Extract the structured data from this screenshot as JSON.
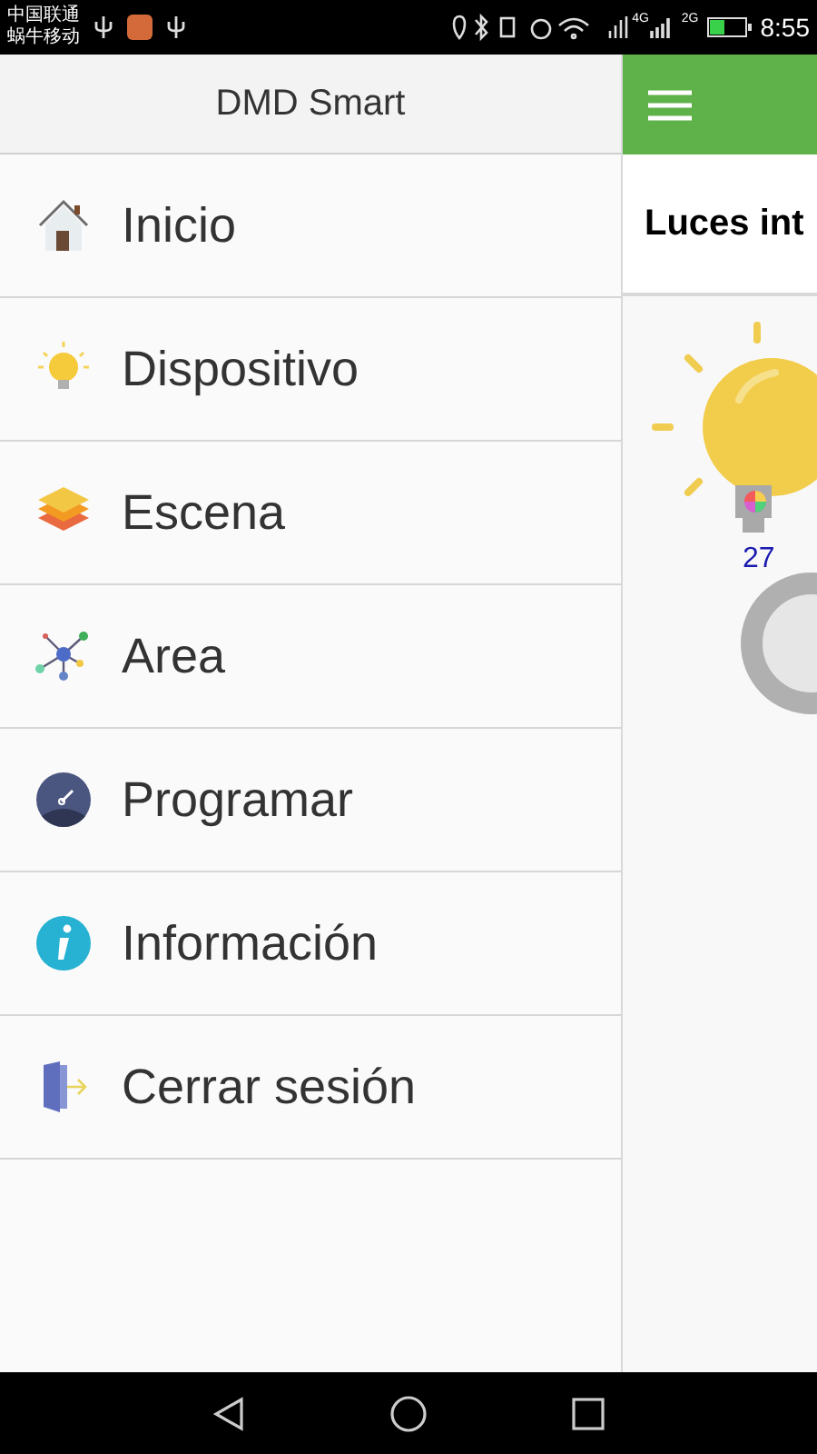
{
  "status_bar": {
    "carriers": [
      "中国联通",
      "蜗牛移动"
    ],
    "network_labels": [
      "4G",
      "2G"
    ],
    "time": "8:55"
  },
  "drawer": {
    "title": "DMD Smart",
    "items": [
      {
        "label": "Inicio",
        "kind": "home"
      },
      {
        "label": "Dispositivo",
        "kind": "bulb"
      },
      {
        "label": "Escena",
        "kind": "layers"
      },
      {
        "label": "Area",
        "kind": "network"
      },
      {
        "label": "Programar",
        "kind": "gauge"
      },
      {
        "label": "Información",
        "kind": "info"
      },
      {
        "label": "Cerrar sesión",
        "kind": "logout"
      }
    ]
  },
  "main": {
    "title": "Luces int",
    "device": {
      "value": "27"
    }
  }
}
